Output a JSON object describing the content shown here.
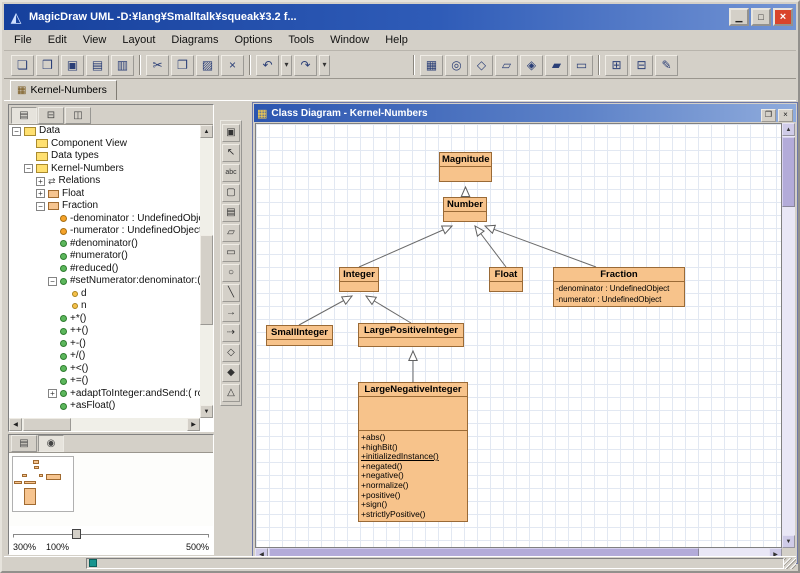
{
  "window": {
    "title": "MagicDraw UML -D:¥lang¥Smalltalk¥squeak¥3.2 f...",
    "controls": [
      {
        "name": "minimize-button",
        "glyph": "▁"
      },
      {
        "name": "maximize-button",
        "glyph": "□"
      },
      {
        "name": "close-button",
        "glyph": "×"
      }
    ]
  },
  "menu": {
    "items": [
      "File",
      "Edit",
      "View",
      "Layout",
      "Diagrams",
      "Options",
      "Tools",
      "Window",
      "Help"
    ]
  },
  "toolbar": {
    "groups": [
      [
        {
          "name": "new-project-button",
          "glyph": "❏"
        },
        {
          "name": "open-project-button",
          "glyph": "❒"
        },
        {
          "name": "save-project-button",
          "glyph": "▣"
        },
        {
          "name": "print-button",
          "glyph": "▤"
        },
        {
          "name": "print-preview-button",
          "glyph": "▥"
        }
      ],
      [
        {
          "name": "cut-button",
          "glyph": "✂"
        },
        {
          "name": "copy-button",
          "glyph": "❐"
        },
        {
          "name": "paste-button",
          "glyph": "▨"
        },
        {
          "name": "delete-button",
          "glyph": "×"
        }
      ],
      [
        {
          "name": "undo-button",
          "glyph": "↶"
        },
        {
          "name": "undo-dropdown",
          "glyph": "▾",
          "narrow": true
        },
        {
          "name": "redo-button",
          "glyph": "↷"
        },
        {
          "name": "redo-dropdown",
          "glyph": "▾",
          "narrow": true
        }
      ],
      [
        {
          "name": "class-diagram-button",
          "glyph": "▦"
        },
        {
          "name": "use-case-diagram-button",
          "glyph": "◎"
        },
        {
          "name": "collaboration-diagram-button",
          "glyph": "◇"
        },
        {
          "name": "sequence-diagram-button",
          "glyph": "▱"
        },
        {
          "name": "statechart-diagram-button",
          "glyph": "◈"
        },
        {
          "name": "activity-diagram-button",
          "glyph": "▰"
        },
        {
          "name": "implementation-diagram-button",
          "glyph": "▭"
        }
      ],
      [
        {
          "name": "add-package-button",
          "glyph": "⊞"
        },
        {
          "name": "remove-package-button",
          "glyph": "⊟"
        },
        {
          "name": "note-button",
          "glyph": "✎"
        }
      ]
    ]
  },
  "workspace_tabs": [
    {
      "label": "Kernel-Numbers"
    }
  ],
  "browser": {
    "tabs": [
      {
        "name": "containment-tree-tab",
        "glyph": "▤",
        "active": true
      },
      {
        "name": "inheritance-tree-tab",
        "glyph": "⊟",
        "active": false
      },
      {
        "name": "diagrams-tree-tab",
        "glyph": "◫",
        "active": false
      }
    ],
    "tree": {
      "items": [
        {
          "label": "Data",
          "depth": 0,
          "icon": "folder",
          "expander": "minus"
        },
        {
          "label": "Component View",
          "depth": 1,
          "icon": "folder",
          "expander": "none"
        },
        {
          "label": "Data types",
          "depth": 1,
          "icon": "folder",
          "expander": "none"
        },
        {
          "label": "Kernel-Numbers",
          "depth": 1,
          "icon": "folder",
          "expander": "minus"
        },
        {
          "label": "Relations",
          "depth": 2,
          "icon": "relations",
          "expander": "plus"
        },
        {
          "label": "Float",
          "depth": 2,
          "icon": "class",
          "expander": "plus"
        },
        {
          "label": "Fraction",
          "depth": 2,
          "icon": "class",
          "expander": "minus"
        },
        {
          "label": "-denominator : UndefinedObjec",
          "depth": 3,
          "icon": "attribute",
          "expander": "none"
        },
        {
          "label": "-numerator : UndefinedObject",
          "depth": 3,
          "icon": "attribute",
          "expander": "none"
        },
        {
          "label": "#denominator()",
          "depth": 3,
          "icon": "operation",
          "expander": "none"
        },
        {
          "label": "#numerator()",
          "depth": 3,
          "icon": "operation",
          "expander": "none"
        },
        {
          "label": "#reduced()",
          "depth": 3,
          "icon": "operation",
          "expander": "none"
        },
        {
          "label": "#setNumerator:denominator:( n",
          "depth": 3,
          "icon": "operation",
          "expander": "minus"
        },
        {
          "label": "d",
          "depth": 4,
          "icon": "param",
          "expander": "none"
        },
        {
          "label": "n",
          "depth": 4,
          "icon": "param",
          "expander": "none"
        },
        {
          "label": "+*()",
          "depth": 3,
          "icon": "operation",
          "expander": "none"
        },
        {
          "label": "++()",
          "depth": 3,
          "icon": "operation",
          "expander": "none"
        },
        {
          "label": "+-()",
          "depth": 3,
          "icon": "operation",
          "expander": "none"
        },
        {
          "label": "+/()",
          "depth": 3,
          "icon": "operation",
          "expander": "none"
        },
        {
          "label": "+<()",
          "depth": 3,
          "icon": "operation",
          "expander": "none"
        },
        {
          "label": "+=()",
          "depth": 3,
          "icon": "operation",
          "expander": "none"
        },
        {
          "label": "+adaptToInteger:andSend:( rc",
          "depth": 3,
          "icon": "operation",
          "expander": "plus"
        },
        {
          "label": "+asFloat()",
          "depth": 3,
          "icon": "operation",
          "expander": "none"
        }
      ]
    }
  },
  "overview": {
    "tabs": [
      {
        "name": "documentation-tab",
        "glyph": "▤",
        "active": false
      },
      {
        "name": "zoom-tab",
        "glyph": "◉",
        "active": true
      }
    ],
    "zoom": {
      "value_label": "300%",
      "min_label": "100%",
      "max_label": "500%"
    }
  },
  "toolstrip": {
    "buttons": [
      {
        "name": "lock-tool",
        "glyph": "▣"
      },
      {
        "name": "select-tool",
        "glyph": "↖"
      },
      {
        "name": "text-tool",
        "glyph": "abc"
      },
      {
        "name": "note-tool",
        "glyph": "▢"
      },
      {
        "name": "anchor-tool",
        "glyph": "▤"
      },
      {
        "name": "package-tool",
        "glyph": "▱"
      },
      {
        "name": "class-tool",
        "glyph": "▭"
      },
      {
        "name": "interface-tool",
        "glyph": "○"
      },
      {
        "name": "line-tool",
        "glyph": "╲"
      },
      {
        "name": "association-tool",
        "glyph": "→"
      },
      {
        "name": "dependency-tool",
        "glyph": "⇢"
      },
      {
        "name": "aggregation-tool",
        "glyph": "◇"
      },
      {
        "name": "composition-tool",
        "glyph": "◆"
      },
      {
        "name": "generalization-tool",
        "glyph": "△"
      }
    ]
  },
  "diagram": {
    "window_title": "Class Diagram - Kernel-Numbers",
    "window_buttons": [
      {
        "name": "diagram-restore-button",
        "glyph": "❐"
      },
      {
        "name": "diagram-close-button",
        "glyph": "×"
      }
    ],
    "classes": [
      {
        "name": "Magnitude"
      },
      {
        "name": "Number"
      },
      {
        "name": "Integer"
      },
      {
        "name": "Float"
      },
      {
        "name": "Fraction",
        "attributes": [
          "-denominator : UndefinedObject",
          "-numerator : UndefinedObject"
        ]
      },
      {
        "name": "SmallInteger"
      },
      {
        "name": "LargePositiveInteger"
      },
      {
        "name": "LargeNegativeInteger",
        "operations": [
          {
            "label": "+abs()"
          },
          {
            "label": "+highBit()"
          },
          {
            "label": "+initializedInstance()",
            "underline": true
          },
          {
            "label": "+negated()"
          },
          {
            "label": "+negative()"
          },
          {
            "label": "+normalize()"
          },
          {
            "label": "+positive()"
          },
          {
            "label": "+sign()"
          },
          {
            "label": "+strictlyPositive()"
          }
        ]
      }
    ],
    "relationships": [
      {
        "type": "generalization",
        "from": "Number",
        "to": "Magnitude"
      },
      {
        "type": "generalization",
        "from": "Integer",
        "to": "Number"
      },
      {
        "type": "generalization",
        "from": "Float",
        "to": "Number"
      },
      {
        "type": "generalization",
        "from": "Fraction",
        "to": "Number"
      },
      {
        "type": "generalization",
        "from": "SmallInteger",
        "to": "Integer"
      },
      {
        "type": "generalization",
        "from": "LargePositiveInteger",
        "to": "Integer"
      },
      {
        "type": "generalization",
        "from": "LargeNegativeInteger",
        "to": "LargePositiveInteger"
      }
    ]
  },
  "colors": {
    "class_fill": "#f7c38b",
    "class_border": "#9a6a36",
    "titlebar_blue": "#2f5cb8",
    "status_indicator": "#17948e"
  }
}
